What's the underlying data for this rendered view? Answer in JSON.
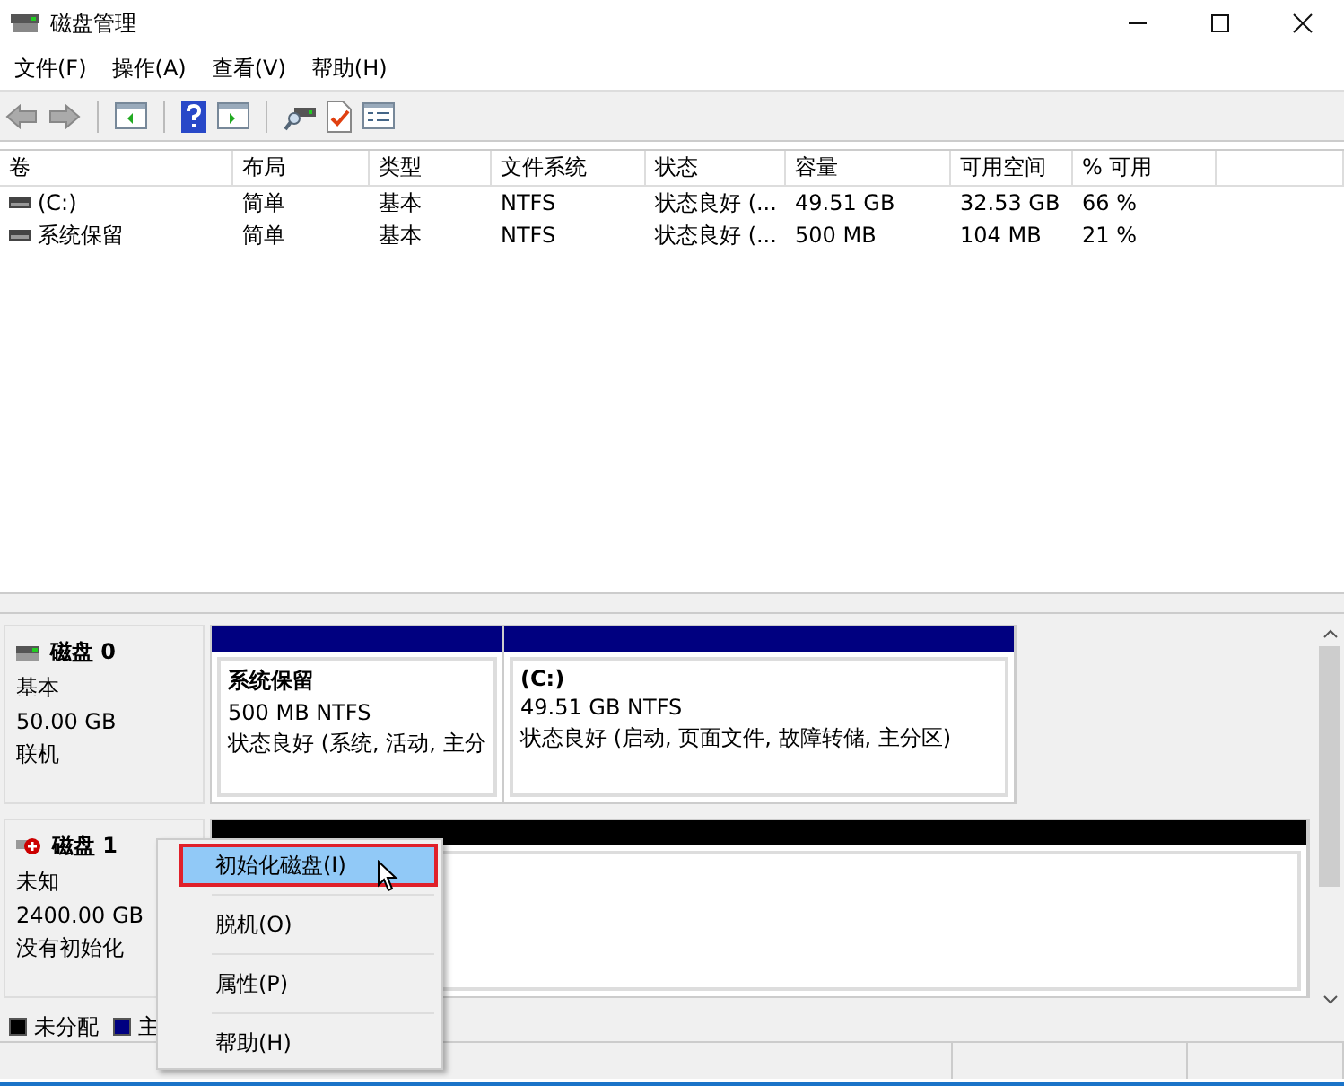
{
  "window": {
    "title": "磁盘管理"
  },
  "menu": [
    "文件(F)",
    "操作(A)",
    "查看(V)",
    "帮助(H)"
  ],
  "volumes": {
    "columns": [
      "卷",
      "布局",
      "类型",
      "文件系统",
      "状态",
      "容量",
      "可用空间",
      "% 可用"
    ],
    "rows": [
      {
        "cells": [
          "(C:)",
          "简单",
          "基本",
          "NTFS",
          "状态良好 (...",
          "49.51 GB",
          "32.53 GB",
          "66 %"
        ]
      },
      {
        "cells": [
          "系统保留",
          "简单",
          "基本",
          "NTFS",
          "状态良好 (...",
          "500 MB",
          "104 MB",
          "21 %"
        ]
      }
    ]
  },
  "disks": [
    {
      "name": "磁盘 0",
      "kind": "online",
      "lines": [
        "基本",
        "50.00 GB",
        "联机"
      ],
      "partitions": [
        {
          "name": "系统保留",
          "size": "500 MB NTFS",
          "status": "状态良好 (系统, 活动, 主分",
          "color": "#000080"
        },
        {
          "name": "(C:)",
          "size": "49.51 GB NTFS",
          "status": "状态良好 (启动, 页面文件, 故障转储, 主分区)",
          "color": "#000080"
        }
      ]
    },
    {
      "name": "磁盘 1",
      "kind": "error",
      "lines": [
        "未知",
        "2400.00 GB",
        "没有初始化"
      ],
      "partitions": [
        {
          "color": "#000000"
        }
      ]
    }
  ],
  "legend": [
    {
      "label": "未分配",
      "color": "#000000"
    },
    {
      "label": "主",
      "color": "#000080"
    }
  ],
  "context_menu": [
    {
      "label": "初始化磁盘(I)",
      "selected": true
    },
    {
      "label": "脱机(O)",
      "selected": false
    },
    {
      "label": "属性(P)",
      "selected": false
    },
    {
      "label": "帮助(H)",
      "selected": false
    }
  ]
}
